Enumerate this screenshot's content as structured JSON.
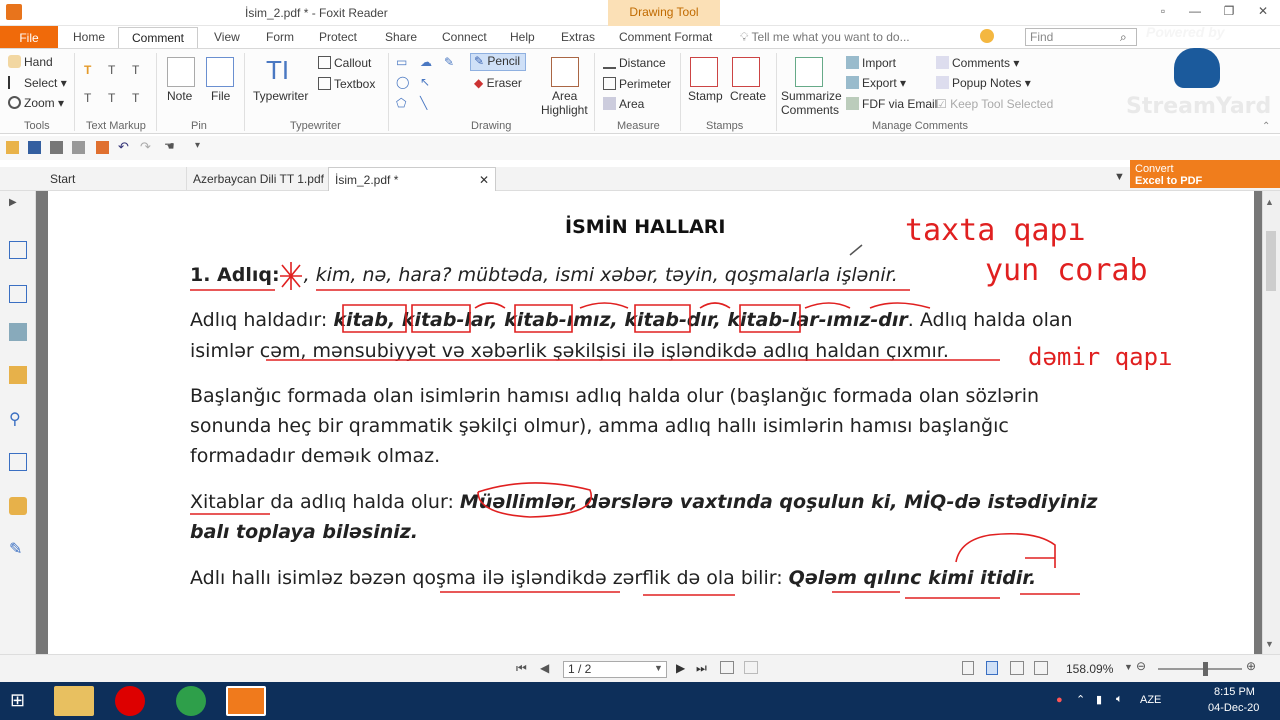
{
  "window": {
    "title": "İsim_2.pdf * - Foxit Reader",
    "context_tab": "Drawing Tool"
  },
  "ribbon_tabs": [
    "File",
    "Home",
    "Comment",
    "View",
    "Form",
    "Protect",
    "Share",
    "Connect",
    "Help",
    "Extras",
    "Comment Format"
  ],
  "tell_me": "Tell me what you want to do...",
  "find_placeholder": "Find",
  "ribbon": {
    "tools": {
      "hand": "Hand",
      "select": "Select",
      "zoom": "Zoom",
      "label": "Tools"
    },
    "text_markup_label": "Text Markup",
    "pin": {
      "note": "Note",
      "file": "File",
      "label": "Pin"
    },
    "typewriter": {
      "typewriter": "Typewriter",
      "callout": "Callout",
      "textbox": "Textbox",
      "label": "Typewriter"
    },
    "drawing": {
      "pencil": "Pencil",
      "eraser": "Eraser",
      "area_highlight_1": "Area",
      "area_highlight_2": "Highlight",
      "label": "Drawing"
    },
    "measure": {
      "distance": "Distance",
      "perimeter": "Perimeter",
      "area": "Area",
      "label": "Measure"
    },
    "stamps": {
      "stamp": "Stamp",
      "create": "Create",
      "label": "Stamps"
    },
    "manage": {
      "summarize_1": "Summarize",
      "summarize_2": "Comments",
      "import": "Import",
      "export": "Export",
      "fdf_email": "FDF via Email",
      "comments": "Comments",
      "popup_notes": "Popup Notes",
      "keep_tool": "Keep Tool Selected",
      "label": "Manage Comments"
    }
  },
  "doc_tabs": [
    "Start",
    "Azerbaycan Dili TT 1.pdf",
    "İsim_2.pdf *"
  ],
  "convert": {
    "line1": "Convert",
    "line2": "Excel to PDF"
  },
  "document": {
    "title": "İSMİN  HALLARI",
    "l1_prefix": "1. Adlıq:",
    "l1_rest": ", kim, nə, hara? mübtəda, ismi xəbər, təyin, qoşmalarla işlənir.",
    "l2_prefix": "Adlıq haldadır: ",
    "l2_examples": "kitab, kitab-lar, kitab-ımız, kitab-dır, kitab-lar-ımız-dır",
    "l2_suffix": ". Adlıq halda olan",
    "l3": "isimlər cəm, mənsubiyyət və xəbərlik şəkilşisi ilə işləndikdə adlıq haldan çıxmır.",
    "p2_l1": "Başlanğıc formada olan isimlərin hamısı adlıq halda olur (başlanğıc formada olan sözlərin",
    "p2_l2": "sonunda heç bir qrammatik şəkilçi olmur), amma adlıq hallı isimlərin hamısı başlanğıc",
    "p2_l3": "formadadır deməık olmaz.",
    "p3_prefix": "Xitablar da adlıq halda olur: ",
    "p3_example": "Müəllimlər, dərslərə vaxtında qoşulun ki, MİQ-də istədiyiniz",
    "p3_l2": "balı toplaya biləsiniz.",
    "p4_prefix": "Adlı hallı isimləz bəzən qoşma ilə işləndikdə zərflik də ola bilir: ",
    "p4_example": "Qələm qılınc kimi itidir."
  },
  "handwriting": {
    "note1": "taxta qapı",
    "note2": "yun corab",
    "note3": "dəmir qapı"
  },
  "status": {
    "page": "1 / 2",
    "zoom": "158.09%"
  },
  "taskbar": {
    "lang": "AZE",
    "time": "8:15 PM",
    "date": "04-Dec-20"
  },
  "overlay": {
    "powered": "Powered by",
    "brand": "StreamYard"
  }
}
